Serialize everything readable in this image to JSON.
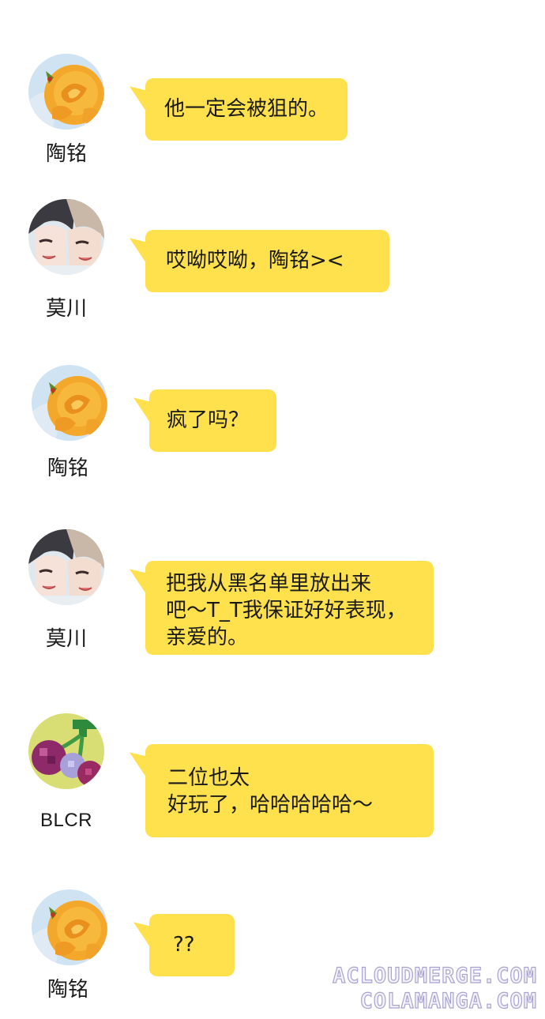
{
  "colors": {
    "bubble": "#ffe04d",
    "background": "#ffffff",
    "name_text": "#1a1a1a",
    "watermark_outline": "#a9a3cf"
  },
  "messages": [
    {
      "sender": "陶铭",
      "avatar_icon": "orange-rose-avatar-icon",
      "lines": [
        "他一定会被狙的。"
      ]
    },
    {
      "sender": "莫川",
      "avatar_icon": "anime-couple-avatar-icon",
      "lines": [
        "哎呦哎呦，陶铭><"
      ]
    },
    {
      "sender": "陶铭",
      "avatar_icon": "orange-rose-avatar-icon",
      "lines": [
        "疯了吗？"
      ]
    },
    {
      "sender": "莫川",
      "avatar_icon": "anime-couple-avatar-icon",
      "lines": [
        "把我从黑名单里放出来",
        "吧～T_T我保证好好表现，",
        "亲爱的。"
      ]
    },
    {
      "sender": "BLCR",
      "avatar_icon": "pixel-cherries-avatar-icon",
      "lines": [
        "二位也太",
        "好玩了，哈哈哈哈哈～"
      ]
    },
    {
      "sender": "陶铭",
      "avatar_icon": "orange-rose-avatar-icon",
      "lines": [
        "??"
      ]
    }
  ],
  "watermark": {
    "line1": "ACLOUDMERGE.COM",
    "line2": "COLAMANGA.COM"
  }
}
